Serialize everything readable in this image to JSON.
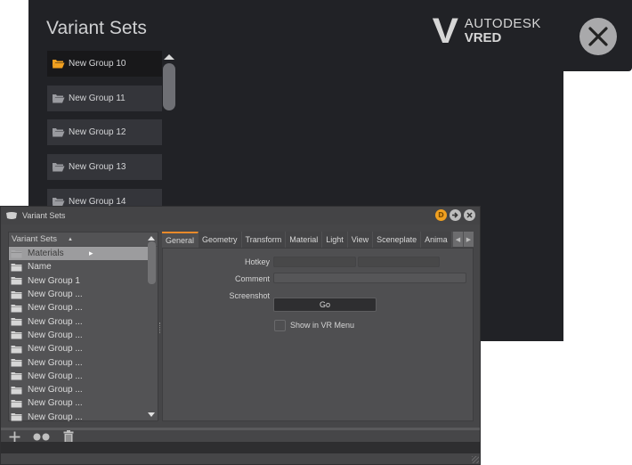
{
  "vr_menu": {
    "title": "Variant Sets",
    "items": [
      {
        "label": "New Group 10",
        "active": true
      },
      {
        "label": "New Group 11",
        "active": false
      },
      {
        "label": "New Group 12",
        "active": false
      },
      {
        "label": "New Group 13",
        "active": false
      },
      {
        "label": "New Group 14",
        "active": false
      }
    ],
    "logo": {
      "line1": "AUTODESK",
      "line2": "VRED",
      "mark": "V"
    },
    "close_icon": "close-x-icon",
    "accent_folder_color": "#f0a020"
  },
  "window": {
    "title": "Variant Sets",
    "buttons": {
      "d_label": "D"
    },
    "tree": {
      "header": "Variant Sets",
      "rows": [
        {
          "label": "Materials",
          "selected": true
        },
        {
          "label": "Name",
          "selected": false
        },
        {
          "label": "New Group 1",
          "selected": false
        },
        {
          "label": "New Group ...",
          "selected": false
        },
        {
          "label": "New Group ...",
          "selected": false
        },
        {
          "label": "New Group ...",
          "selected": false
        },
        {
          "label": "New Group ...",
          "selected": false
        },
        {
          "label": "New Group ...",
          "selected": false
        },
        {
          "label": "New Group ...",
          "selected": false
        },
        {
          "label": "New Group ...",
          "selected": false
        },
        {
          "label": "New Group ...",
          "selected": false
        },
        {
          "label": "New Group ...",
          "selected": false
        },
        {
          "label": "New Group ...",
          "selected": false
        }
      ]
    },
    "tabs": [
      "General",
      "Geometry",
      "Transform",
      "Material",
      "Light",
      "View",
      "Sceneplate",
      "Anima"
    ],
    "active_tab": "General",
    "accent_color": "#e98a2a",
    "general": {
      "hotkey_label": "Hotkey",
      "hotkey_value_1": "",
      "hotkey_value_2": "",
      "comment_label": "Comment",
      "comment_value": "",
      "screenshot_label": "Screenshot",
      "go_label": "Go",
      "show_vr_label": "Show in VR Menu",
      "show_vr_checked": false
    },
    "toolbar": [
      "add-icon",
      "dots-icon",
      "trash-icon"
    ]
  }
}
